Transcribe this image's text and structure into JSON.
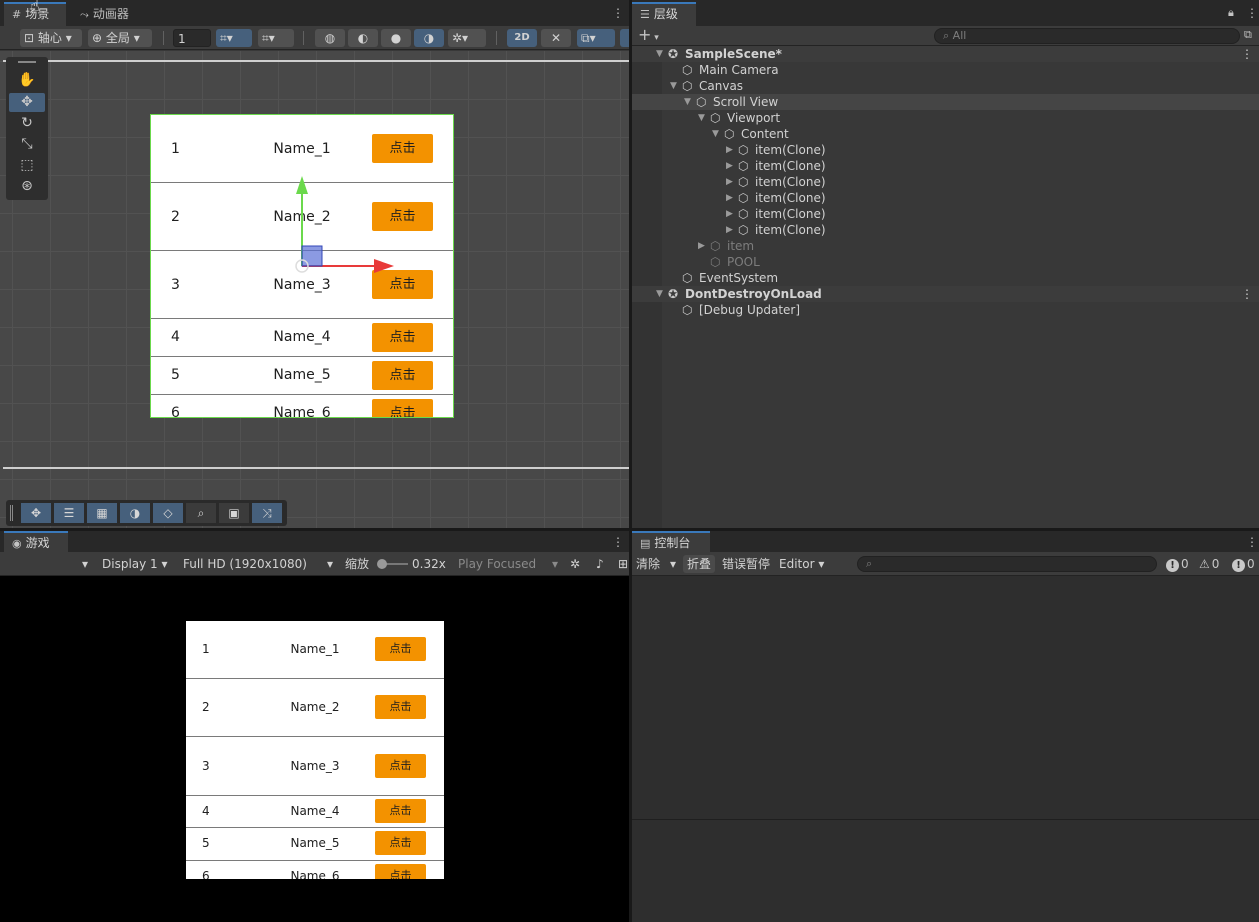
{
  "scene_panel": {
    "tabs": [
      {
        "label": "场景",
        "icon": "grid-icon"
      },
      {
        "label": "动画器",
        "icon": "animator-icon"
      }
    ],
    "toolbar": {
      "pivot_label": "轴心",
      "space_label": "全局",
      "grid_value": "1",
      "mode_2d_label": "2D"
    }
  },
  "scene_items": [
    {
      "index": "1",
      "name": "Name_1",
      "button": "点击"
    },
    {
      "index": "2",
      "name": "Name_2",
      "button": "点击"
    },
    {
      "index": "3",
      "name": "Name_3",
      "button": "点击"
    },
    {
      "index": "4",
      "name": "Name_4",
      "button": "点击"
    },
    {
      "index": "5",
      "name": "Name_5",
      "button": "点击"
    },
    {
      "index": "6",
      "name": "Name_6",
      "button": "点击"
    }
  ],
  "hierarchy": {
    "tab_label": "层级",
    "search_placeholder": "All",
    "items": [
      {
        "label": "SampleScene*",
        "indent": 0,
        "type": "scene"
      },
      {
        "label": "Main Camera",
        "indent": 1
      },
      {
        "label": "Canvas",
        "indent": 1
      },
      {
        "label": "Scroll View",
        "indent": 2
      },
      {
        "label": "Viewport",
        "indent": 3
      },
      {
        "label": "Content",
        "indent": 4
      },
      {
        "label": "item(Clone)",
        "indent": 5
      },
      {
        "label": "item(Clone)",
        "indent": 5
      },
      {
        "label": "item(Clone)",
        "indent": 5
      },
      {
        "label": "item(Clone)",
        "indent": 5
      },
      {
        "label": "item(Clone)",
        "indent": 5
      },
      {
        "label": "item(Clone)",
        "indent": 5
      },
      {
        "label": "item",
        "indent": 3,
        "dim": true
      },
      {
        "label": "POOL",
        "indent": 3,
        "dim": true
      },
      {
        "label": "EventSystem",
        "indent": 1
      },
      {
        "label": "DontDestroyOnLoad",
        "indent": 0,
        "type": "scene"
      },
      {
        "label": "[Debug Updater]",
        "indent": 1
      }
    ]
  },
  "game_panel": {
    "tab_label": "游戏",
    "display": "Display 1",
    "resolution": "Full HD (1920x1080)",
    "scale_label": "缩放",
    "scale_value": "0.32x",
    "play_mode": "Play Focused"
  },
  "game_items": [
    {
      "index": "1",
      "name": "Name_1",
      "button": "点击"
    },
    {
      "index": "2",
      "name": "Name_2",
      "button": "点击"
    },
    {
      "index": "3",
      "name": "Name_3",
      "button": "点击"
    },
    {
      "index": "4",
      "name": "Name_4",
      "button": "点击"
    },
    {
      "index": "5",
      "name": "Name_5",
      "button": "点击"
    },
    {
      "index": "6",
      "name": "Name_6",
      "button": "点击"
    }
  ],
  "console": {
    "tab_label": "控制台",
    "clear_label": "清除",
    "collapse_label": "折叠",
    "error_pause_label": "错误暂停",
    "editor_label": "Editor",
    "info_count": "0",
    "warn_count": "0",
    "error_count": "0"
  },
  "colors": {
    "accent": "#3a79bb",
    "button_orange": "#f39200",
    "selection_green": "#6bd94c"
  }
}
